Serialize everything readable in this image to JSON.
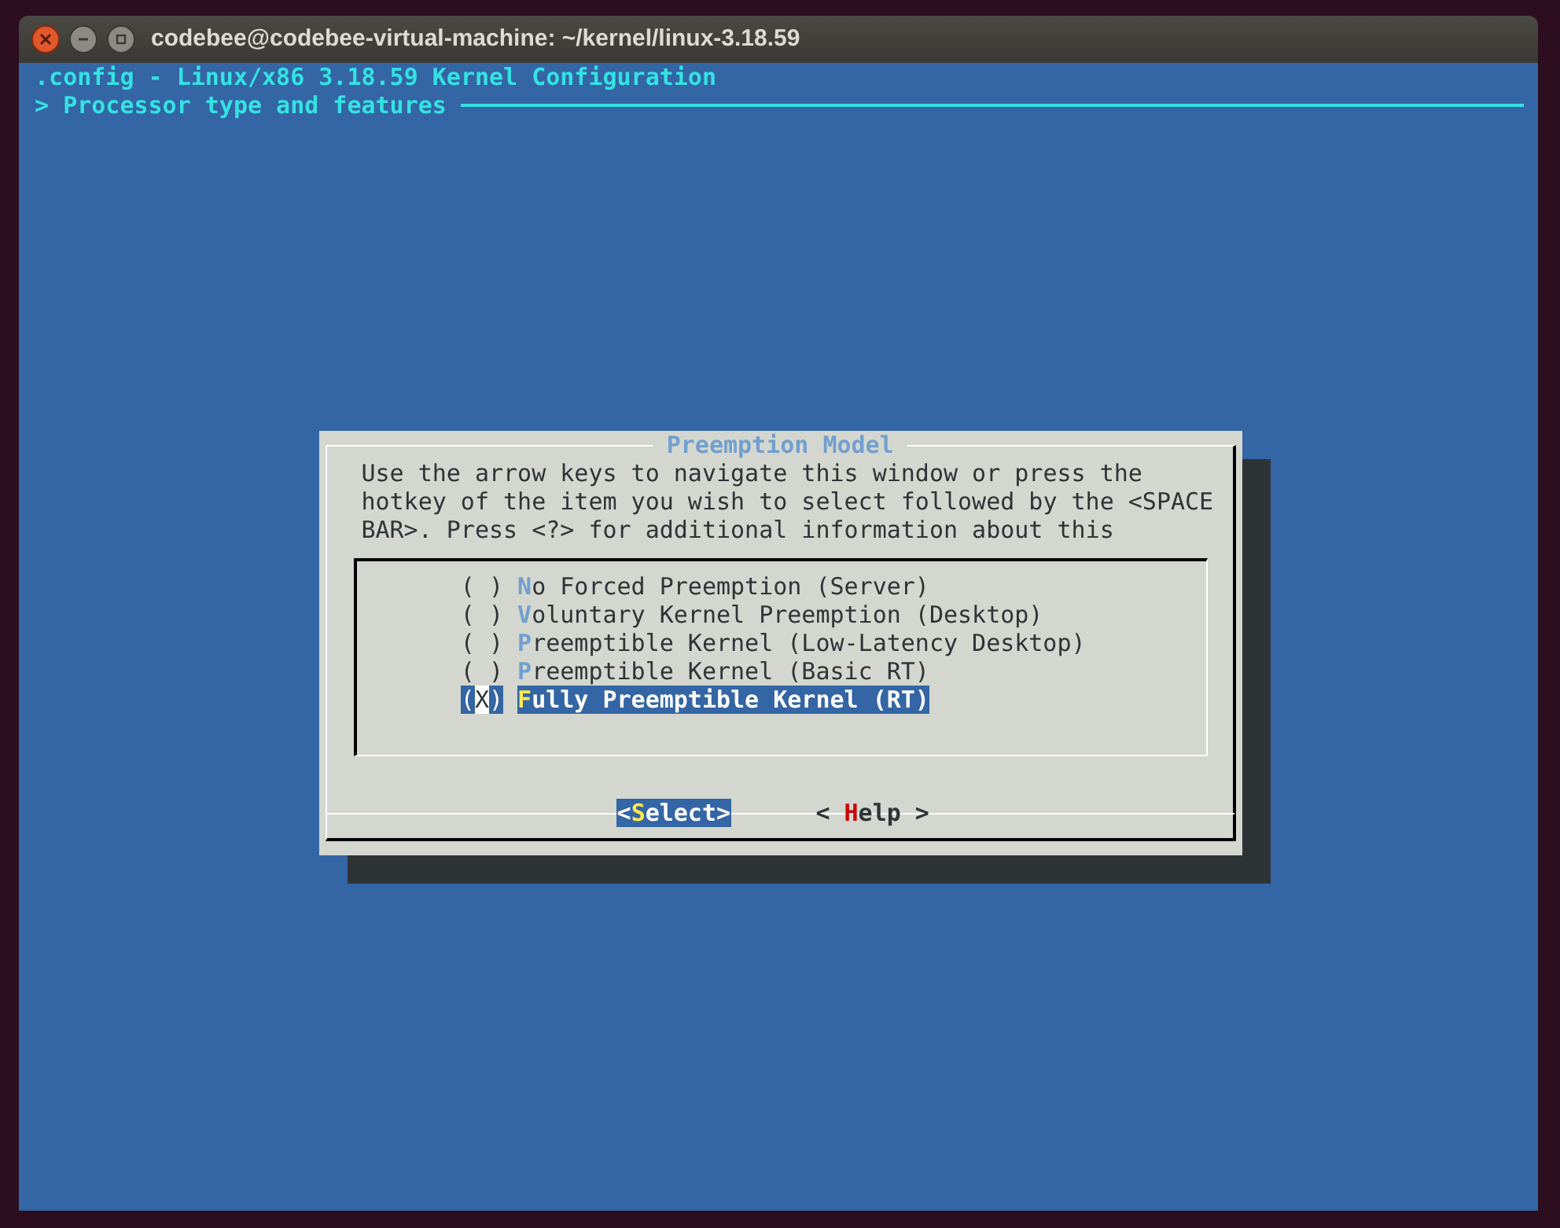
{
  "window": {
    "title": "codebee@codebee-virtual-machine: ~/kernel/linux-3.18.59"
  },
  "terminal": {
    "header": ".config - Linux/x86 3.18.59 Kernel Configuration",
    "breadcrumb": "> Processor type and features"
  },
  "dialog": {
    "title": "Preemption Model",
    "help_lines": [
      "Use the arrow keys to navigate this window or press the",
      "hotkey of the item you wish to select followed by the <SPACE",
      "BAR>. Press <?> for additional information about this"
    ],
    "options": [
      {
        "marker": "( )",
        "hotkey": "N",
        "rest": "o Forced Preemption (Server)",
        "selected": false
      },
      {
        "marker": "( )",
        "hotkey": "V",
        "rest": "oluntary Kernel Preemption (Desktop)",
        "selected": false
      },
      {
        "marker": "( )",
        "hotkey": "P",
        "rest": "reemptible Kernel (Low-Latency Desktop)",
        "selected": false
      },
      {
        "marker": "( )",
        "hotkey": "P",
        "rest": "reemptible Kernel (Basic RT)",
        "selected": false
      },
      {
        "marker": "(X)",
        "hotkey": "F",
        "rest": "ully Preemptible Kernel (RT)",
        "selected": true
      }
    ],
    "buttons": [
      {
        "prefix": "<",
        "hotkey": "S",
        "rest": "elect>",
        "selected": true
      },
      {
        "prefix": "< ",
        "hotkey": "H",
        "rest": "elp >",
        "selected": false
      }
    ]
  }
}
